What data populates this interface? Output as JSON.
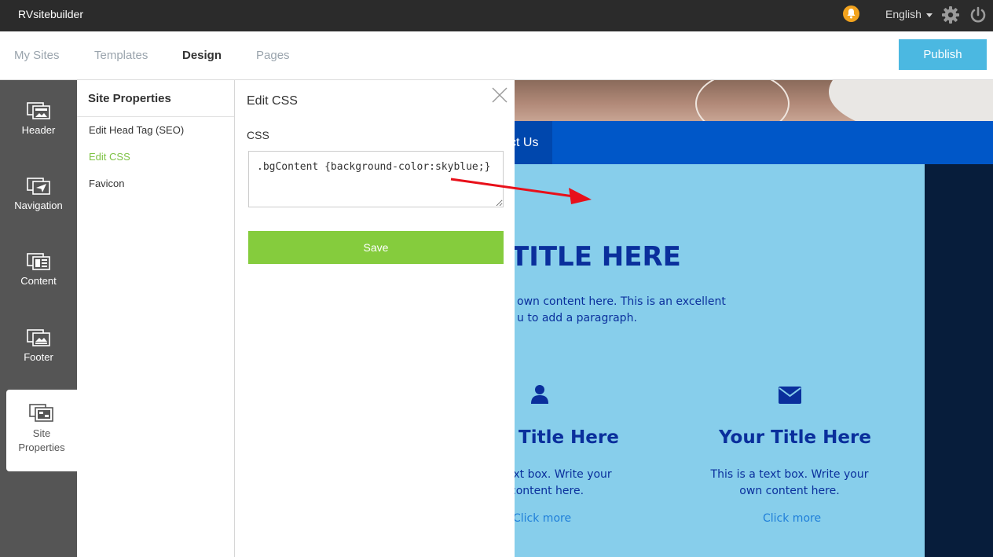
{
  "app": {
    "brand": "RVsitebuilder"
  },
  "topbar": {
    "language": "English"
  },
  "nav": {
    "tabs": [
      {
        "label": "My Sites"
      },
      {
        "label": "Templates"
      },
      {
        "label": "Design"
      },
      {
        "label": "Pages"
      }
    ],
    "active_tab": "Design",
    "publish_label": "Publish"
  },
  "rail": {
    "items": [
      {
        "label": "Header"
      },
      {
        "label": "Navigation"
      },
      {
        "label": "Content"
      },
      {
        "label": "Footer"
      },
      {
        "label_line1": "Site",
        "label_line2": "Properties"
      }
    ],
    "active": "Site Properties"
  },
  "site_properties": {
    "title": "Site Properties",
    "links": [
      {
        "label": "Edit Head Tag (SEO)"
      },
      {
        "label": "Edit CSS"
      },
      {
        "label": "Favicon"
      }
    ],
    "active_link": "Edit CSS"
  },
  "edit_css": {
    "title": "Edit CSS",
    "field_label": "CSS",
    "value": ".bgContent {background-color:skyblue;}",
    "save_label": "Save"
  },
  "preview": {
    "nav_item": "ct Us",
    "title": "TITLE HERE",
    "intro_line1": "own content here. This is an excellent",
    "intro_line2": "u to add a paragraph.",
    "col1": {
      "title": "Title Here",
      "text_line1": "ext box. Write your",
      "text_line2": "content here.",
      "link": "Click more"
    },
    "col2": {
      "title": "Your Title Here",
      "text_line1": "This is a text box. Write your",
      "text_line2": "own content here.",
      "link": "Click more"
    }
  },
  "colors": {
    "topbar": "#2b2b2b",
    "publish": "#4bb8e1",
    "save": "#85cc3d",
    "active_link": "#7dc243",
    "site_nav": "#0057c8",
    "content_bg": "#87ceeb",
    "heading": "#0a2f9c",
    "arrow": "#e8101a"
  }
}
